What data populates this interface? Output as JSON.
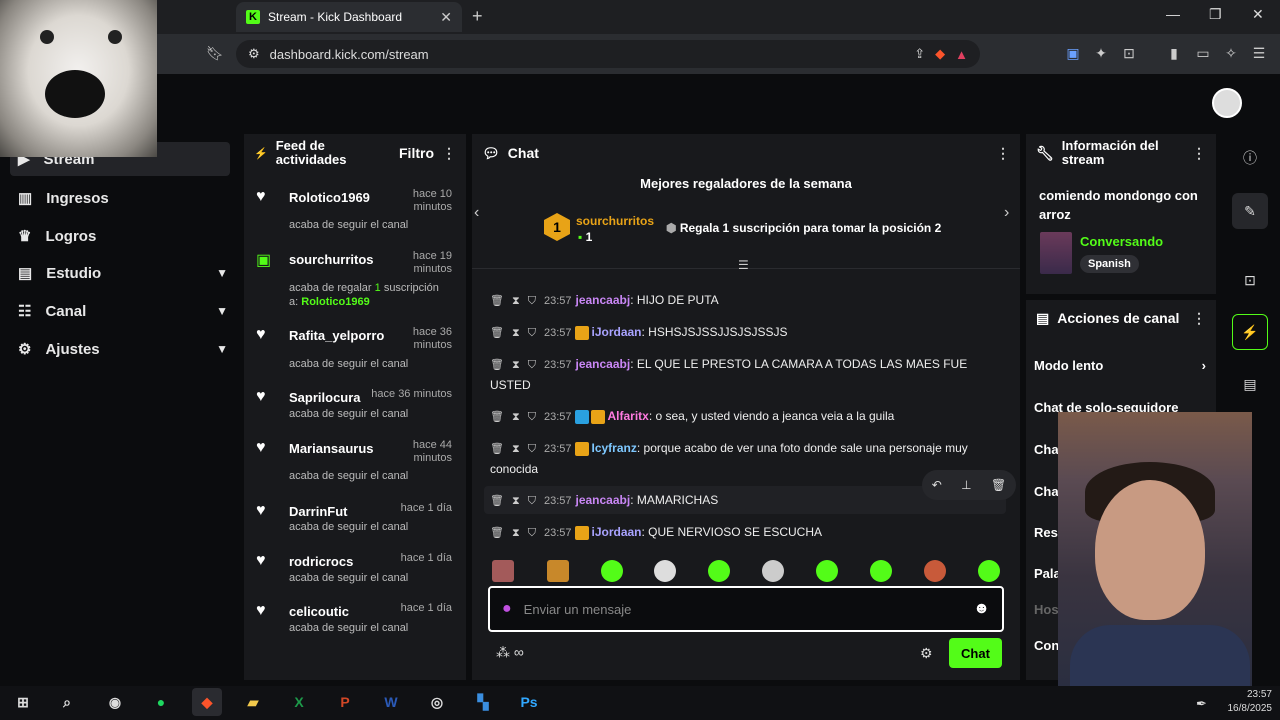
{
  "browser": {
    "tab_title": "Stream - Kick Dashboard",
    "tab_favicon": "K",
    "url": "dashboard.kick.com/stream"
  },
  "nav": {
    "items": [
      {
        "label": "Stream",
        "icon": "stream-icon"
      },
      {
        "label": "Ingresos",
        "icon": "chart-icon"
      },
      {
        "label": "Logros",
        "icon": "trophy-icon"
      },
      {
        "label": "Estudio",
        "icon": "studio-icon",
        "expandable": true
      },
      {
        "label": "Canal",
        "icon": "people-icon",
        "expandable": true
      },
      {
        "label": "Ajustes",
        "icon": "gear-icon",
        "expandable": true
      }
    ]
  },
  "feed": {
    "title": "Feed de actividades",
    "filter_label": "Filtro",
    "items": [
      {
        "name": "Rolotico1969",
        "time": "hace 10 minutos",
        "action": "acaba de seguir el canal"
      },
      {
        "name": "sourchurritos",
        "time": "hace 19 minutos",
        "action_prefix": "acaba de regalar",
        "count": "1",
        "action_mid": "suscripción a:",
        "target": "Rolotico1969"
      },
      {
        "name": "Rafita_yelporro",
        "time": "hace 36 minutos",
        "action": "acaba de seguir el canal"
      },
      {
        "name": "Saprilocura",
        "time": "hace 36 minutos",
        "action": "acaba de seguir el canal"
      },
      {
        "name": "Mariansaurus",
        "time": "hace 44 minutos",
        "action": "acaba de seguir el canal"
      },
      {
        "name": "DarrinFut",
        "time": "hace 1 día",
        "action": "acaba de seguir el canal"
      },
      {
        "name": "rodricrocs",
        "time": "hace 1 día",
        "action": "acaba de seguir el canal"
      },
      {
        "name": "celicoutic",
        "time": "hace 1 día",
        "action": "acaba de seguir el canal"
      }
    ]
  },
  "chat": {
    "title": "Chat",
    "gifters_title": "Mejores regaladores de la semana",
    "top_gifter": {
      "rank": "1",
      "name": "sourchurritos",
      "count": "1"
    },
    "gift_prompt": "Regala 1 suscripción para tomar la posición 2",
    "messages": [
      {
        "time": "23:57",
        "user": "jeancaabj",
        "color": "#c987f5",
        "badges": [],
        "text": "HIJO DE PUTA"
      },
      {
        "time": "23:57",
        "user": "iJordaan",
        "color": "#a9a3ff",
        "badges": [
          "crown"
        ],
        "text": "HSHSJSJSSJJSJSJSSJS"
      },
      {
        "time": "23:57",
        "user": "jeancaabj",
        "color": "#c987f5",
        "badges": [],
        "text": "EL QUE LE PRESTO LA CAMARA A TODAS LAS MAES FUE USTED"
      },
      {
        "time": "23:57",
        "user": "Alfaritx",
        "color": "#ff7be0",
        "badges": [
          "hammer",
          "crown"
        ],
        "text": "o sea, y usted viendo a jeanca veia a la guila"
      },
      {
        "time": "23:57",
        "user": "Icyfranz",
        "color": "#7ec8ff",
        "badges": [
          "crown"
        ],
        "text": "porque acabo de ver una foto donde sale una personaje muy conocida"
      },
      {
        "time": "23:57",
        "user": "jeancaabj",
        "color": "#c987f5",
        "badges": [],
        "text": "MAMARICHAS"
      },
      {
        "time": "23:57",
        "user": "iJordaan",
        "color": "#a9a3ff",
        "badges": [
          "crown"
        ],
        "text": "QUE NERVIOSO SE ESCUCHA"
      }
    ],
    "input_placeholder": "Enviar un mensaje",
    "send_label": "Chat",
    "infinity": "∞"
  },
  "info": {
    "title": "Información del stream",
    "stream_title": "comiendo mondongo con arroz",
    "category": "Conversando",
    "language": "Spanish"
  },
  "actions": {
    "title": "Acciones de canal",
    "items": [
      "Modo lento",
      "Chat de solo-seguidore",
      "Cha",
      "Cha",
      "Rest",
      "Pala",
      "Hos",
      "Con"
    ]
  },
  "taskbar": {
    "time": "23:57",
    "date": "16/8/2025"
  },
  "colors": {
    "accent": "#53fc18",
    "panel": "#18191c",
    "bg": "#0b0c0e"
  }
}
